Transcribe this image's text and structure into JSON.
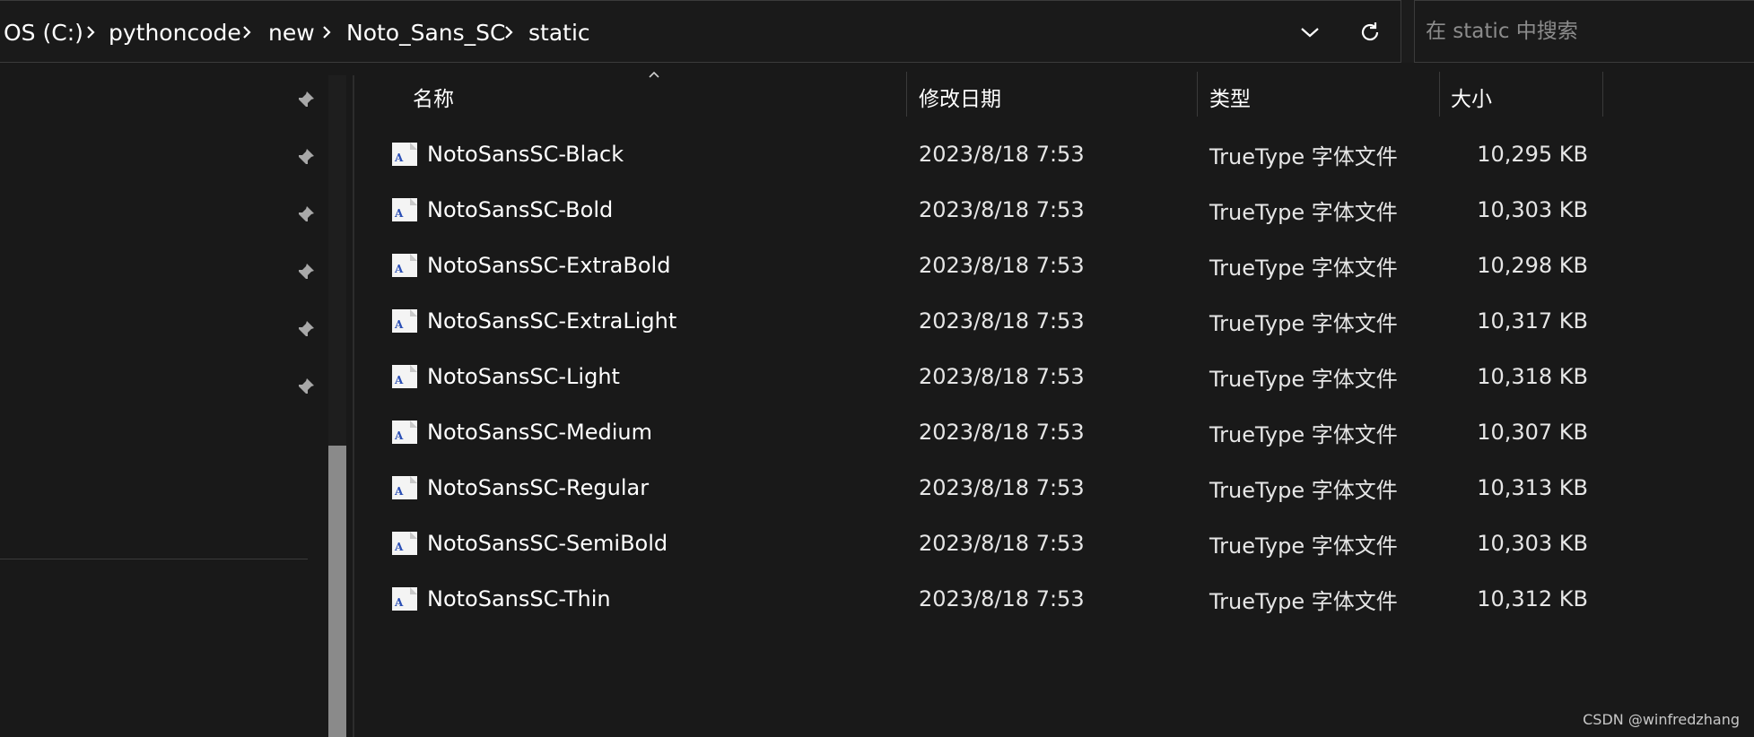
{
  "address_bar": {
    "crumbs": [
      "OS (C:)",
      "pythoncode",
      "new",
      "Noto_Sans_SC",
      "static"
    ]
  },
  "search": {
    "placeholder": "在 static 中搜索"
  },
  "columns": {
    "name": "名称",
    "modified": "修改日期",
    "type": "类型",
    "size": "大小"
  },
  "files": [
    {
      "name": "NotoSansSC-Black",
      "modified": "2023/8/18 7:53",
      "type": "TrueType 字体文件",
      "size": "10,295 KB"
    },
    {
      "name": "NotoSansSC-Bold",
      "modified": "2023/8/18 7:53",
      "type": "TrueType 字体文件",
      "size": "10,303 KB"
    },
    {
      "name": "NotoSansSC-ExtraBold",
      "modified": "2023/8/18 7:53",
      "type": "TrueType 字体文件",
      "size": "10,298 KB"
    },
    {
      "name": "NotoSansSC-ExtraLight",
      "modified": "2023/8/18 7:53",
      "type": "TrueType 字体文件",
      "size": "10,317 KB"
    },
    {
      "name": "NotoSansSC-Light",
      "modified": "2023/8/18 7:53",
      "type": "TrueType 字体文件",
      "size": "10,318 KB"
    },
    {
      "name": "NotoSansSC-Medium",
      "modified": "2023/8/18 7:53",
      "type": "TrueType 字体文件",
      "size": "10,307 KB"
    },
    {
      "name": "NotoSansSC-Regular",
      "modified": "2023/8/18 7:53",
      "type": "TrueType 字体文件",
      "size": "10,313 KB"
    },
    {
      "name": "NotoSansSC-SemiBold",
      "modified": "2023/8/18 7:53",
      "type": "TrueType 字体文件",
      "size": "10,303 KB"
    },
    {
      "name": "NotoSansSC-Thin",
      "modified": "2023/8/18 7:53",
      "type": "TrueType 字体文件",
      "size": "10,312 KB"
    }
  ],
  "icons": {
    "breadcrumb_separator": "chevron-right-icon",
    "history": "chevron-down-icon",
    "refresh": "refresh-icon",
    "pin": "pin-icon",
    "file": "font-file-icon",
    "sort": "sort-ascending-icon"
  },
  "watermark": "CSDN @winfredzhang",
  "colors": {
    "background": "#191919",
    "border": "#3b3b3b",
    "text": "#ffffff",
    "scroll_thumb": "#8a8a8a",
    "font_icon_accent": "#2b4fb5"
  }
}
